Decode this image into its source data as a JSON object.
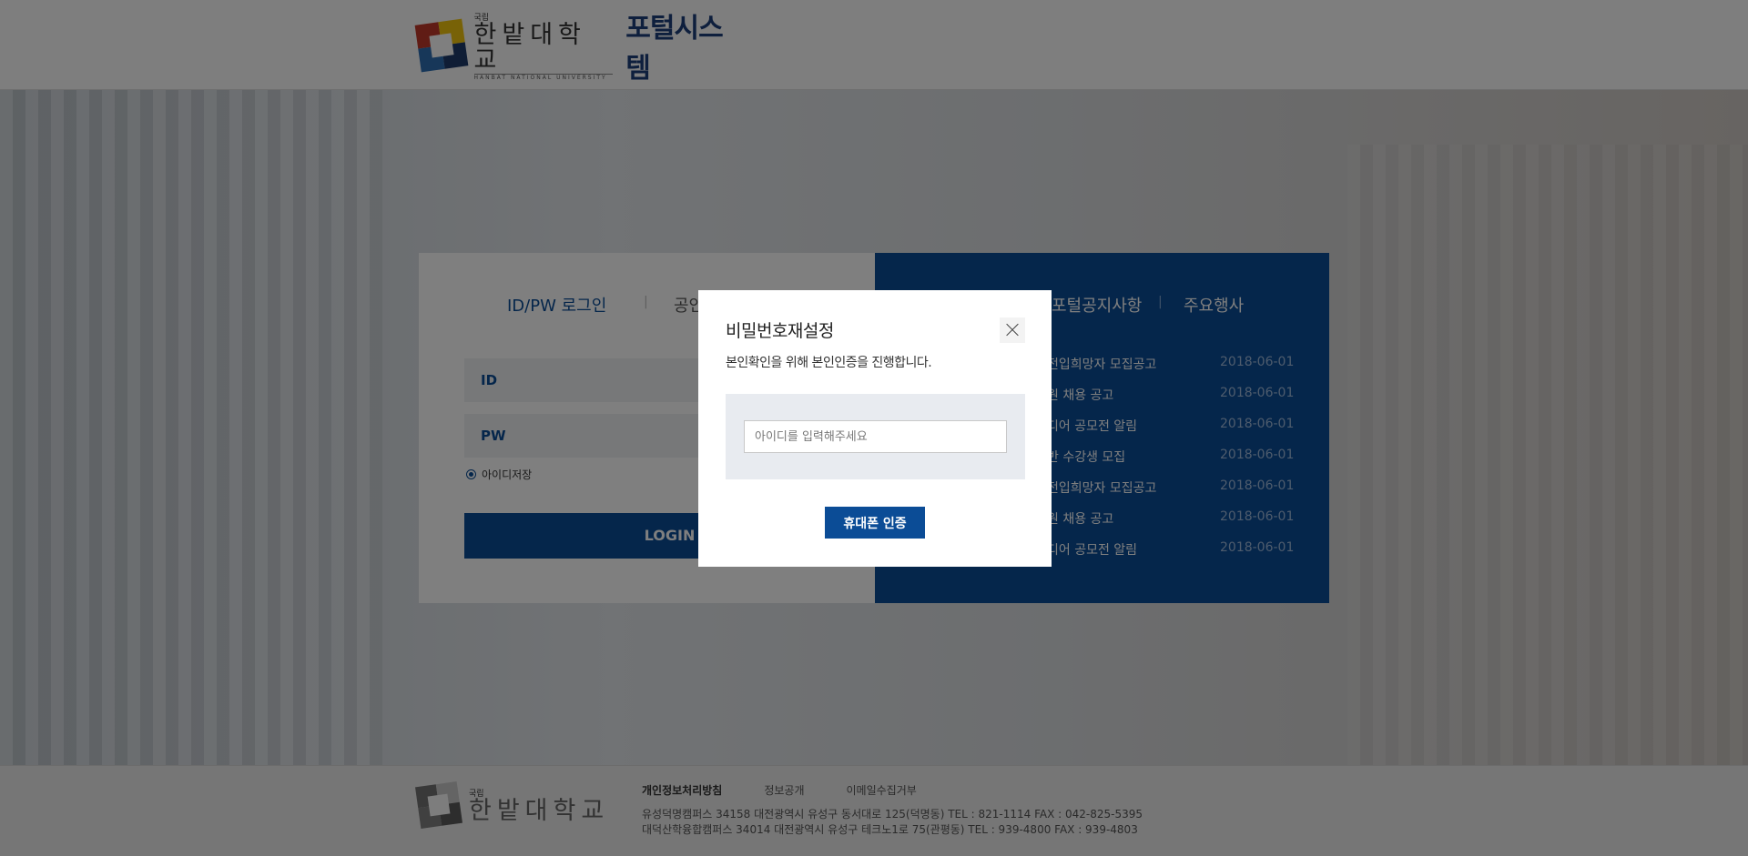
{
  "header": {
    "logo_small": "국립",
    "logo_name": "한밭대학교",
    "logo_eng": "HANBAT NATIONAL UNIVERSITY",
    "portal_title": "포털시스템"
  },
  "login": {
    "tab_idpw": "ID/PW 로그인",
    "tab_cert": "공인",
    "id_label": "ID",
    "pw_label": "PW",
    "save_id": "아이디저장",
    "login_button": "LOGIN"
  },
  "board": {
    "tab_notice": "포털공지사항",
    "tab_event": "주요행사",
    "items": [
      {
        "title": "전입희망자 모집공고",
        "date": "2018-06-01"
      },
      {
        "title": "원 채용 공고",
        "date": "2018-06-01"
      },
      {
        "title": "디어 공모전 알림",
        "date": "2018-06-01"
      },
      {
        "title": "반 수강생 모집",
        "date": "2018-06-01"
      },
      {
        "title": "전입희망자 모집공고",
        "date": "2018-06-01"
      },
      {
        "title": "원 채용 공고",
        "date": "2018-06-01"
      },
      {
        "title": "디어 공모전 알림",
        "date": "2018-06-01"
      }
    ]
  },
  "footer": {
    "logo_small": "국립",
    "logo_name": "한밭대학교",
    "links": [
      "개인정보처리방침",
      "정보공개",
      "이메일수집거부"
    ],
    "address1": "유성덕명캠퍼스  34158 대전광역시 유성구 동서대로 125(덕명동)  TEL : 821-1114  FAX : 042-825-5395",
    "address2": "대덕산학융합캠퍼스  34014 대전광역시 유성구 테크노1로 75(관평동)  TEL : 939-4800  FAX : 939-4803"
  },
  "modal": {
    "title": "비밀번호재설정",
    "description": "본인확인을 위해 본인인증을 진행합니다.",
    "input_placeholder": "아이디를 입력해주세요",
    "phone_button": "휴대폰 인증"
  },
  "colors": {
    "brand": "#0b4c96",
    "overlay": "rgba(0,0,0,0.5)"
  }
}
